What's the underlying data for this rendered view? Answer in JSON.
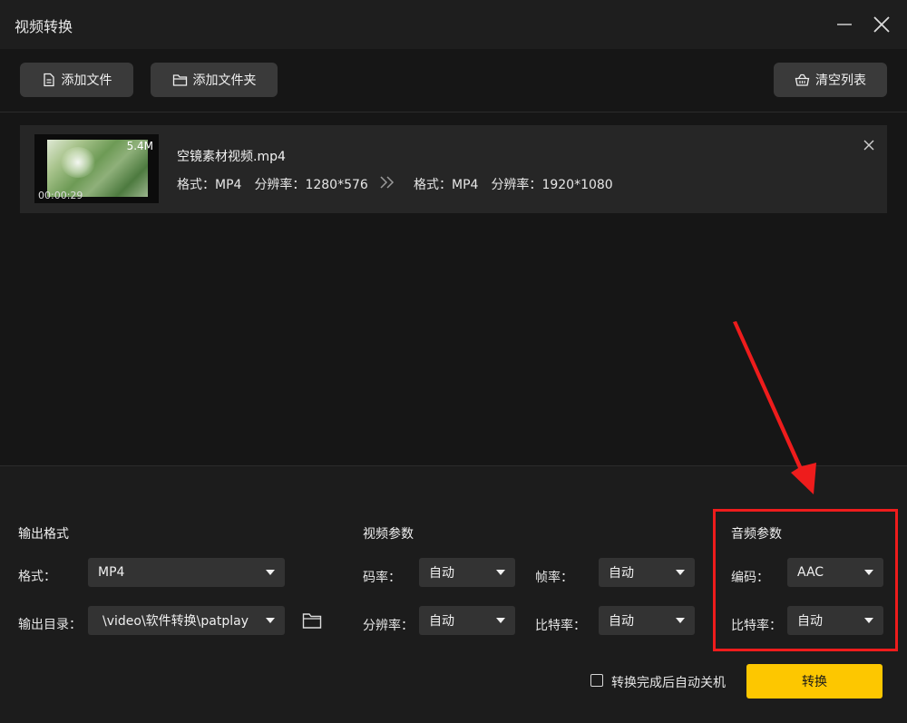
{
  "window": {
    "title": "视频转换"
  },
  "toolbar": {
    "add_file": "添加文件",
    "add_folder": "添加文件夹",
    "clear_list": "清空列表"
  },
  "file": {
    "name": "空镜素材视频.mp4",
    "size": "5.4M",
    "duration": "00:00:29",
    "source": {
      "format_label": "格式：",
      "format": "MP4",
      "resolution_label": "分辨率：",
      "resolution": "1280*576"
    },
    "target": {
      "format_label": "格式：",
      "format": "MP4",
      "resolution_label": "分辨率：",
      "resolution": "1920*1080"
    }
  },
  "output": {
    "title": "输出格式",
    "format_label": "格式：",
    "format_value": "MP4",
    "dir_label": "输出目录：",
    "dir_value": "\\video\\软件转换\\patplay"
  },
  "video_params": {
    "title": "视频参数",
    "bitrate_label": "码率：",
    "bitrate_value": "自动",
    "framerate_label": "帧率：",
    "framerate_value": "自动",
    "resolution_label": "分辨率：",
    "resolution_value": "自动",
    "ratio_label": "比特率：",
    "ratio_value": "自动"
  },
  "audio_params": {
    "title": "音频参数",
    "codec_label": "编码：",
    "codec_value": "AAC",
    "bitrate_label": "比特率：",
    "bitrate_value": "自动"
  },
  "footer": {
    "shutdown_label": "转换完成后自动关机",
    "shutdown_checked": false,
    "convert_button": "转换"
  },
  "colors": {
    "accent": "#fdc700",
    "annotation": "#ee1c1c",
    "background": "#161616"
  }
}
